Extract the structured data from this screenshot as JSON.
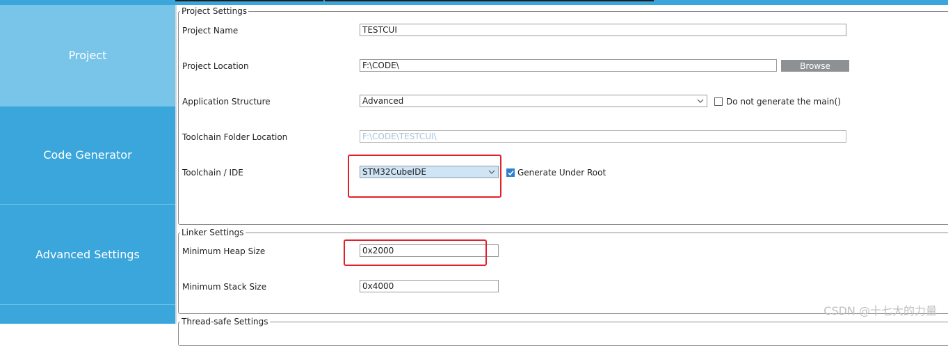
{
  "sidebar": {
    "items": [
      {
        "label": "Project"
      },
      {
        "label": "Code Generator"
      },
      {
        "label": "Advanced Settings"
      }
    ]
  },
  "project_settings": {
    "legend": "Project Settings",
    "project_name": {
      "label": "Project Name",
      "value": "TESTCUI"
    },
    "project_location": {
      "label": "Project Location",
      "value": "F:\\CODE\\",
      "browse_label": "Browse"
    },
    "application_structure": {
      "label": "Application Structure",
      "value": "Advanced",
      "checkbox_label": "Do not generate the main()",
      "checkbox_checked": false
    },
    "toolchain_folder": {
      "label": "Toolchain Folder Location",
      "value": "F:\\CODE\\TESTCUI\\"
    },
    "toolchain_ide": {
      "label": "Toolchain / IDE",
      "value": "STM32CubeIDE",
      "checkbox_label": "Generate Under Root",
      "checkbox_checked": true
    }
  },
  "linker_settings": {
    "legend": "Linker Settings",
    "min_heap": {
      "label": "Minimum Heap Size",
      "value": "0x2000"
    },
    "min_stack": {
      "label": "Minimum Stack Size",
      "value": "0x4000"
    }
  },
  "thread_safe_settings": {
    "legend": "Thread-safe Settings"
  },
  "watermark": "CSDN @十七大的力量",
  "colors": {
    "sidebar": "#3aa6dc",
    "sidebar_active": "#79c5ea",
    "annotation": "#e0202a",
    "checkbox_checked": "#2e7fd0"
  }
}
